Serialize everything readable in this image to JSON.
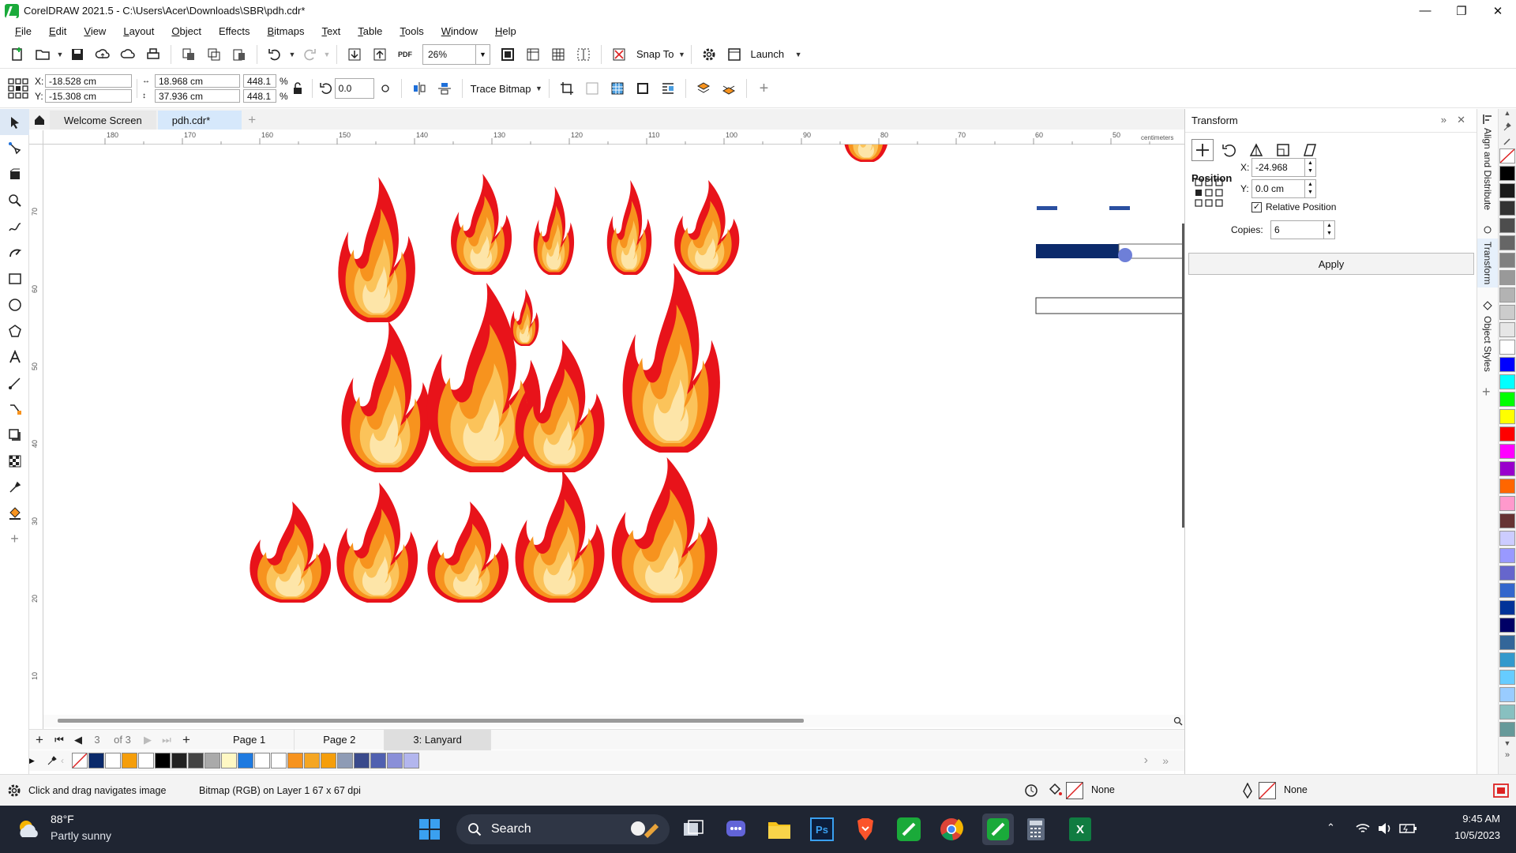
{
  "app": {
    "title": "CorelDRAW 2021.5 - C:\\Users\\Acer\\Downloads\\SBR\\pdh.cdr*",
    "window_controls": [
      "minimize-icon",
      "restore-icon",
      "close-icon"
    ]
  },
  "menu": [
    "File",
    "Edit",
    "View",
    "Layout",
    "Object",
    "Effects",
    "Bitmaps",
    "Text",
    "Table",
    "Tools",
    "Window",
    "Help"
  ],
  "menu_underline": [
    "F",
    "E",
    "V",
    "L",
    "O",
    "C",
    "B",
    "T",
    "T",
    "T",
    "W",
    "H"
  ],
  "toolbar": {
    "pdf_label": "PDF",
    "zoom_value": "26%",
    "snap_to": "Snap To",
    "launch": "Launch"
  },
  "propbar": {
    "x_label": "X:",
    "x_value": "-18.528 cm",
    "y_label": "Y:",
    "y_value": "-15.308 cm",
    "width_value": "18.968 cm",
    "height_value": "37.936 cm",
    "scale_w": "448.1",
    "scale_h": "448.1",
    "percent": "%",
    "rotation": "0.0",
    "trace_bitmap": "Trace Bitmap"
  },
  "doc_tabs": [
    "Welcome Screen",
    "pdh.cdr*"
  ],
  "ruler": {
    "unit": "centimeters",
    "h_ticks": [
      "180",
      "170",
      "160",
      "150",
      "140",
      "130",
      "120",
      "110",
      "100",
      "90",
      "80",
      "70",
      "60",
      "50"
    ],
    "v_ticks": [
      "70",
      "60",
      "50",
      "40",
      "30",
      "20",
      "10"
    ]
  },
  "page_nav": {
    "counter": "3",
    "of": "of 3",
    "pages": [
      "Page 1",
      "Page 2",
      "3: Lanyard"
    ],
    "active_page": "3: Lanyard"
  },
  "palette_colors": [
    "#0b2a6b",
    "#ffffff",
    "#f59e0b",
    "#ffffff",
    "#000000",
    "#222222",
    "#444444",
    "#aaaaaa",
    "#fff8c4",
    "#1e7ae0",
    "#ffffff",
    "#ffffff",
    "#f7931e",
    "#f5a623",
    "#f59e0b",
    "#8e9bb5",
    "#3a4a8c",
    "#5060b0",
    "#8a8fd8",
    "#b3b6ee"
  ],
  "status": {
    "hint": "Click and drag navigates image",
    "object_info": "Bitmap (RGB) on Layer 1 67 x 67 dpi",
    "fill": "None",
    "outline": "None"
  },
  "transform_docker": {
    "title": "Transform",
    "section": "Position",
    "x_label": "X:",
    "x_value": "-24.968 cm",
    "y_label": "Y:",
    "y_value": "0.0 cm",
    "relative_position": "Relative Position",
    "relative_checked": true,
    "copies_label": "Copies:",
    "copies_value": "6",
    "apply": "Apply"
  },
  "docker_tabs": [
    "Align and Distribute",
    "Transform",
    "Object Styles"
  ],
  "color_bar": [
    "#000000",
    "#1a1a1a",
    "#333333",
    "#4d4d4d",
    "#666666",
    "#808080",
    "#999999",
    "#b3b3b3",
    "#cccccc",
    "#e6e6e6",
    "#ffffff",
    "#0000ff",
    "#00ffff",
    "#00ff00",
    "#ffff00",
    "#ff0000",
    "#ff00ff",
    "#9900cc",
    "#ff6600",
    "#ff99cc",
    "#663333",
    "#ccccff",
    "#9999ff",
    "#6666cc",
    "#3366cc",
    "#003399",
    "#000066",
    "#336699",
    "#3399cc",
    "#66ccff",
    "#99ccff",
    "#88c0c0",
    "#669999"
  ],
  "taskbar": {
    "weather_temp": "88°F",
    "weather_desc": "Partly sunny",
    "search": "Search",
    "time": "9:45 AM",
    "date": "10/5/2023"
  }
}
